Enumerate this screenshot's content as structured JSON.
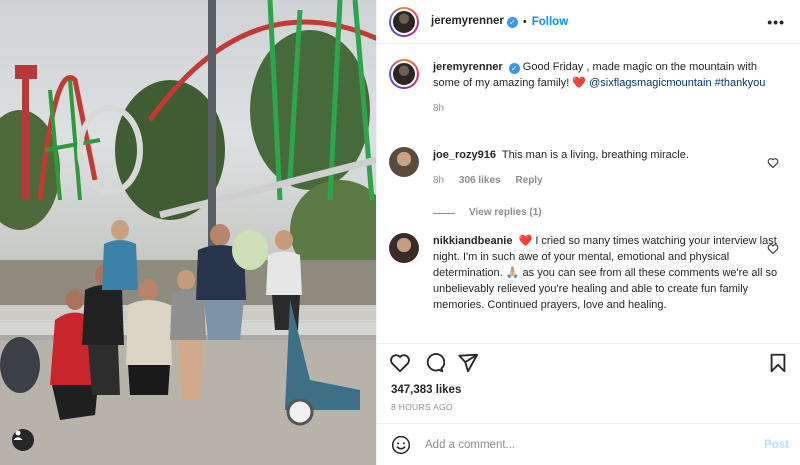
{
  "author": {
    "username": "jeremyrenner",
    "follow_label": "Follow",
    "more_label": "•••",
    "dot": "•",
    "verified_glyph": "✓"
  },
  "caption": {
    "username": "jeremyrenner",
    "text": "Good Friday , made magic on the mountain with some of my amazing family! ",
    "heart": "❤️",
    "mention": "@sixflagsmagicmountain",
    "hashtag": "#thankyou",
    "time": "8h"
  },
  "comments": [
    {
      "username": "joe_rozy916",
      "text": "This man is a living, breathing miracle.",
      "time": "8h",
      "likes": "306 likes",
      "reply": "Reply",
      "view_replies": "View replies (1)"
    },
    {
      "username": "nikkiandbeanie",
      "heart": "❤️",
      "text": "I cried so many times watching your interview last night. I'm in such awe of your mental, emotional and physical determination. 🙏🏼 as you can see from all these comments we're all so unbelievably relieved you're healing and able to create fun family memories. Continued prayers, love and healing."
    }
  ],
  "post": {
    "likes": "347,383 likes",
    "time": "8 HOURS AGO"
  },
  "composer": {
    "placeholder": "Add a comment...",
    "post_label": "Post"
  },
  "colors": {
    "link_blue": "#0095f6",
    "heart_red": "#ed4956",
    "muted": "#8e8e8e",
    "text": "#262626"
  },
  "icons": [
    "heart-icon",
    "comment-icon",
    "share-icon",
    "bookmark-icon",
    "emoji-icon",
    "user-tag-icon",
    "verified-icon",
    "more-options-icon"
  ]
}
